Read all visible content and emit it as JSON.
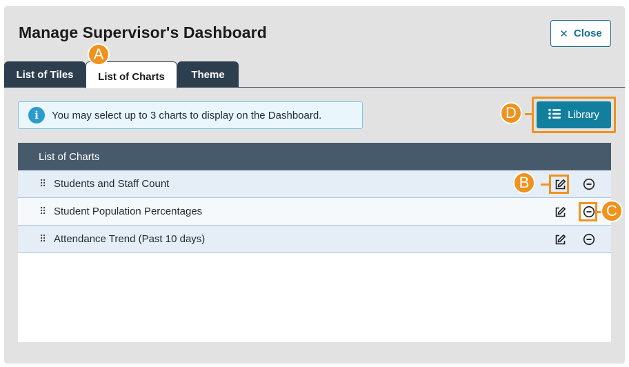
{
  "dialog": {
    "title": "Manage Supervisor's Dashboard",
    "close_label": "Close"
  },
  "tabs": [
    {
      "label": "List of Tiles",
      "active": false
    },
    {
      "label": "List of Charts",
      "active": true
    },
    {
      "label": "Theme",
      "active": false
    }
  ],
  "info": {
    "icon": "info-icon",
    "message": "You may select up to 3 charts to display on the Dashboard."
  },
  "library": {
    "label": "Library",
    "icon": "list-icon"
  },
  "table": {
    "header": "List of Charts",
    "rows": [
      {
        "name": "Students and Staff Count"
      },
      {
        "name": "Student Population Percentages"
      },
      {
        "name": "Attendance Trend (Past 10 days)"
      }
    ]
  },
  "callouts": {
    "a": "A",
    "b": "B",
    "c": "C",
    "d": "D"
  },
  "colors": {
    "accent": "#137f9e",
    "highlight": "#f0921e",
    "tab_dark": "#2d3e4f",
    "header": "#475a6b"
  }
}
